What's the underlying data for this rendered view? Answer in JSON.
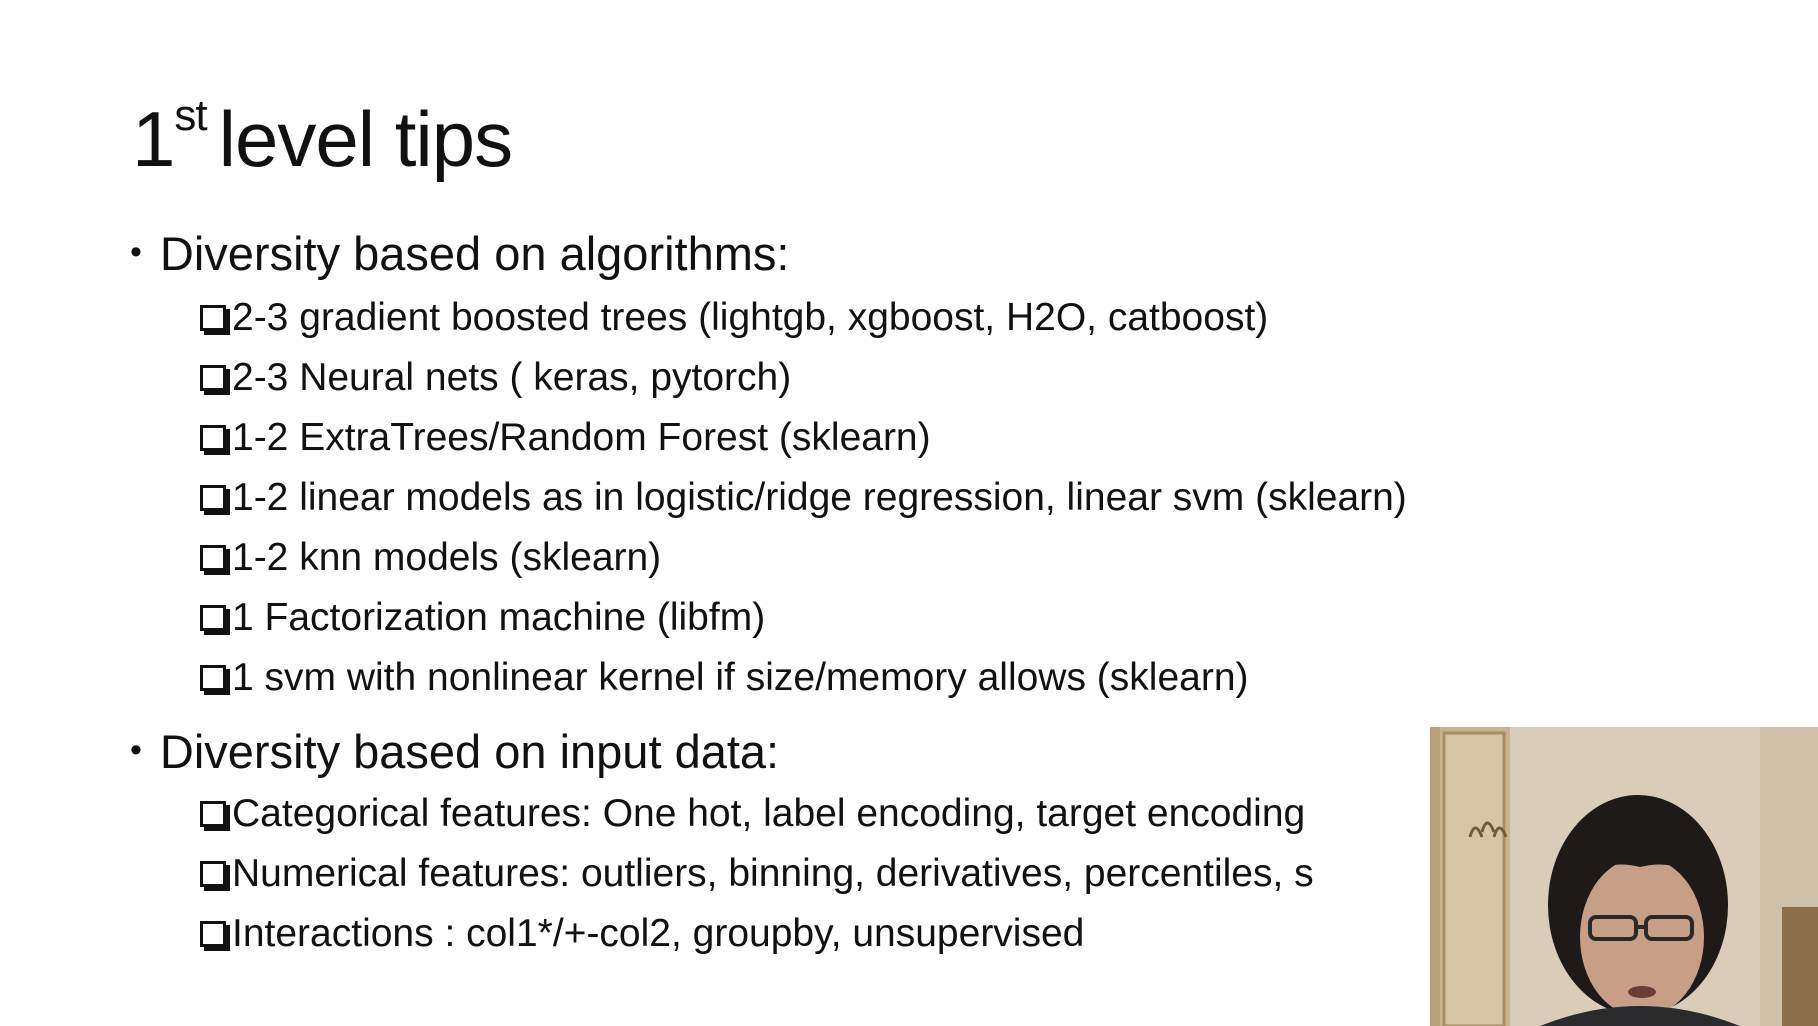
{
  "slide": {
    "title_main": "1",
    "title_sup": "st",
    "title_rest": "level tips",
    "sections": [
      {
        "heading": "Diversity based on algorithms:",
        "items": [
          " 2-3 gradient boosted trees (lightgb, xgboost, H2O, catboost)",
          "2-3 Neural nets ( keras, pytorch)",
          "1-2 ExtraTrees/Random Forest (sklearn)",
          "1-2 linear models as in logistic/ridge regression, linear svm  (sklearn)",
          "1-2 knn models (sklearn)",
          "1 Factorization machine (libfm)",
          "1 svm with nonlinear kernel if size/memory allows (sklearn)"
        ]
      },
      {
        "heading": "Diversity based on input data:",
        "items": [
          "Categorical features: One hot, label encoding, target encoding",
          "Numerical features: outliers, binning, derivatives, percentiles, s",
          "Interactions : col1*/+-col2, groupby, unsupervised"
        ]
      }
    ]
  },
  "icons": {
    "bullet": "bullet-dot",
    "checkbox": "checkbox-square-icon"
  },
  "colors": {
    "background": "#ffffff",
    "text": "#111111",
    "webcam_wall": "#d8cbb7"
  }
}
